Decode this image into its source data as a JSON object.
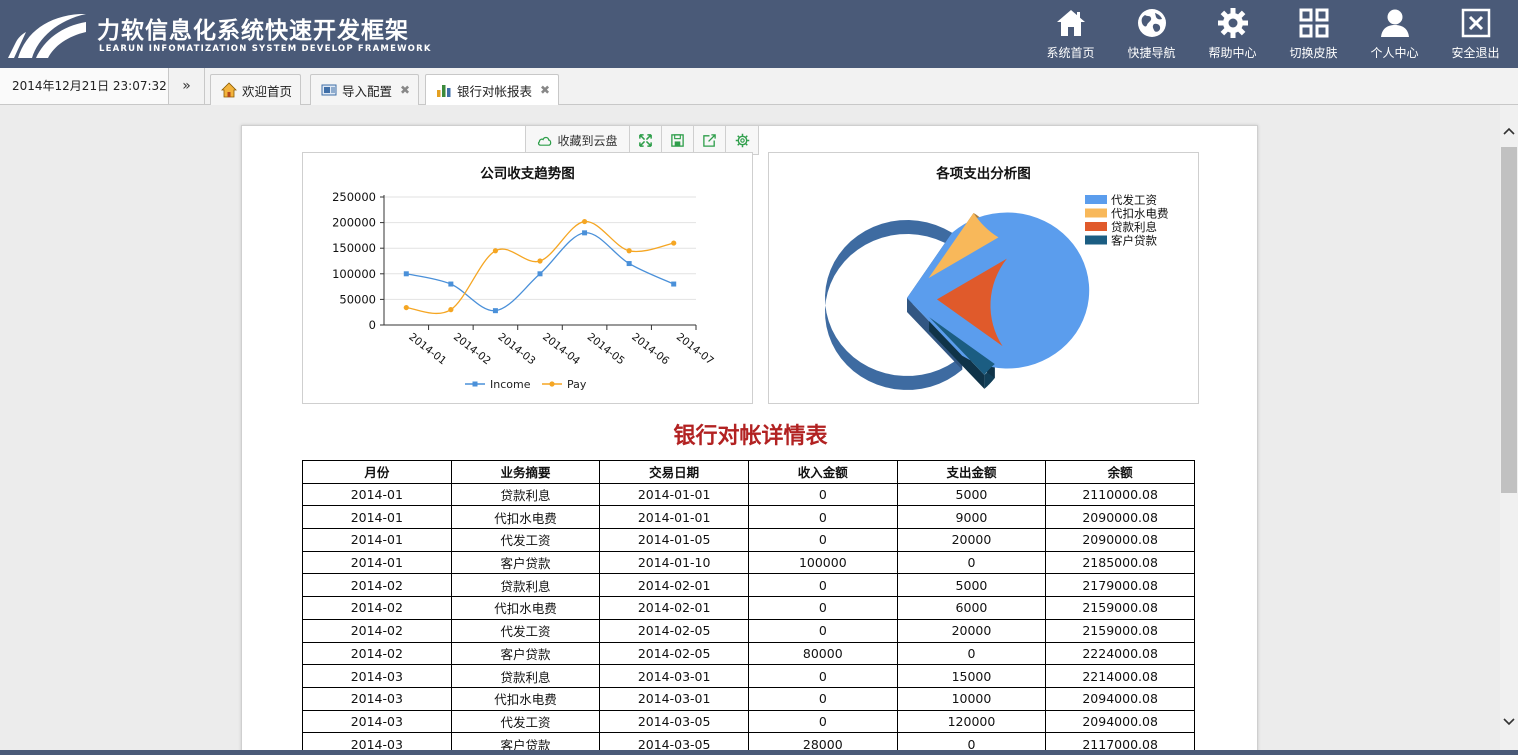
{
  "header": {
    "title": "力软信息化系统快速开发框架",
    "subtitle": "LEARUN INFOMATIZATION SYSTEM DEVELOP FRAMEWORK",
    "nav": [
      {
        "label": "系统首页",
        "icon": "home-icon"
      },
      {
        "label": "快捷导航",
        "icon": "globe-icon"
      },
      {
        "label": "帮助中心",
        "icon": "gear-icon"
      },
      {
        "label": "切换皮肤",
        "icon": "grid-icon"
      },
      {
        "label": "个人中心",
        "icon": "user-icon"
      },
      {
        "label": "安全退出",
        "icon": "close-box-icon"
      }
    ]
  },
  "tabbar": {
    "datetime": "2014年12月21日 23:07:32",
    "more": "»",
    "tabs": [
      {
        "label": "欢迎首页",
        "icon": "home-tab-icon",
        "closable": false
      },
      {
        "label": "导入配置",
        "icon": "import-icon",
        "closable": true
      },
      {
        "label": "银行对帐报表",
        "icon": "bar-chart-icon",
        "closable": true,
        "active": true
      }
    ]
  },
  "toolbar": {
    "cloud_label": "收藏到云盘"
  },
  "colors": {
    "header_bg": "#4a5a78",
    "income": "#4a90d9",
    "pay": "#f5a623",
    "report_title": "#b22222"
  },
  "report": {
    "title": "银行对帐详情表",
    "columns": [
      "月份",
      "业务摘要",
      "交易日期",
      "收入金额",
      "支出金额",
      "余额"
    ],
    "rows": [
      [
        "2014-01",
        "贷款利息",
        "2014-01-01",
        "0",
        "5000",
        "2110000.08"
      ],
      [
        "2014-01",
        "代扣水电费",
        "2014-01-01",
        "0",
        "9000",
        "2090000.08"
      ],
      [
        "2014-01",
        "代发工资",
        "2014-01-05",
        "0",
        "20000",
        "2090000.08"
      ],
      [
        "2014-01",
        "客户贷款",
        "2014-01-10",
        "100000",
        "0",
        "2185000.08"
      ],
      [
        "2014-02",
        "贷款利息",
        "2014-02-01",
        "0",
        "5000",
        "2179000.08"
      ],
      [
        "2014-02",
        "代扣水电费",
        "2014-02-01",
        "0",
        "6000",
        "2159000.08"
      ],
      [
        "2014-02",
        "代发工资",
        "2014-02-05",
        "0",
        "20000",
        "2159000.08"
      ],
      [
        "2014-02",
        "客户贷款",
        "2014-02-05",
        "80000",
        "0",
        "2224000.08"
      ],
      [
        "2014-03",
        "贷款利息",
        "2014-03-01",
        "0",
        "15000",
        "2214000.08"
      ],
      [
        "2014-03",
        "代扣水电费",
        "2014-03-01",
        "0",
        "10000",
        "2094000.08"
      ],
      [
        "2014-03",
        "代发工资",
        "2014-03-05",
        "0",
        "120000",
        "2094000.08"
      ],
      [
        "2014-03",
        "客户贷款",
        "2014-03-05",
        "28000",
        "0",
        "2117000.08"
      ]
    ]
  },
  "chart_data": [
    {
      "type": "line",
      "title": "公司收支趋势图",
      "categories": [
        "2014-01",
        "2014-02",
        "2014-03",
        "2014-04",
        "2014-05",
        "2014-06",
        "2014-07"
      ],
      "series": [
        {
          "name": "Income",
          "values": [
            100000,
            80000,
            28000,
            100000,
            180000,
            120000,
            80000
          ],
          "color": "#4a90d9"
        },
        {
          "name": "Pay",
          "values": [
            34000,
            30000,
            145000,
            125000,
            202000,
            145000,
            160000
          ],
          "color": "#f5a623"
        }
      ],
      "yticks": [
        "250000",
        "200000",
        "150000",
        "100000",
        "50000",
        "0"
      ],
      "ylim": [
        0,
        250000
      ],
      "grid": true,
      "legend": "bottom"
    },
    {
      "type": "pie",
      "title": "各项支出分析图",
      "slices": [
        {
          "name": "代发工资",
          "value": 71,
          "color": "#5b9ded"
        },
        {
          "name": "代扣水电费",
          "value": 7,
          "color": "#f8b85a"
        },
        {
          "name": "贷款利息",
          "value": 19,
          "color": "#e05a2b"
        },
        {
          "name": "客户贷款",
          "value": 3,
          "color": "#1b5d82"
        }
      ],
      "legend": "top-right",
      "style": "3d-exploded"
    }
  ]
}
